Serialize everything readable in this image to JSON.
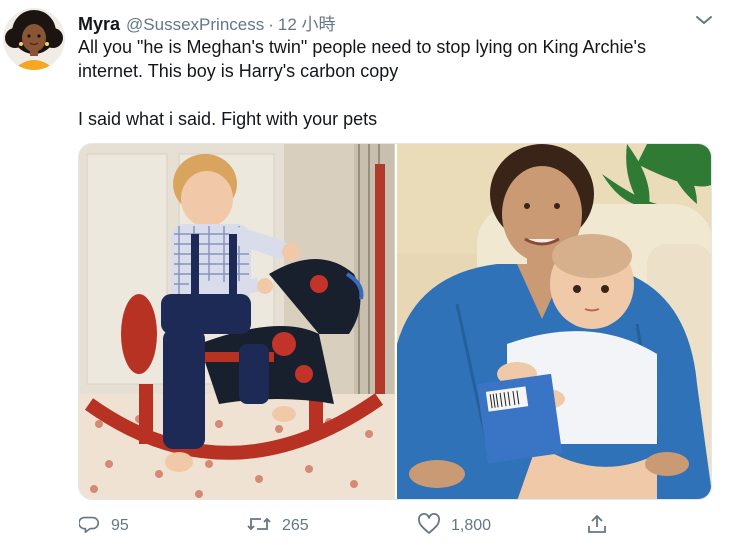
{
  "tweet": {
    "author": {
      "display_name": "Myra",
      "handle": "@SussexPrincess",
      "separator": "·",
      "time": "12 小時"
    },
    "text_lines": [
      "All you \"he is Meghan's twin\" people need to stop lying on King Archie's",
      "internet. This boy is Harry's carbon copy",
      "I said what i said. Fight with your pets"
    ],
    "media": {
      "images": [
        {
          "name": "toddler-on-rocking-horse-photo"
        },
        {
          "name": "woman-holding-baby-photo"
        }
      ]
    },
    "actions": {
      "reply_count": "95",
      "retweet_count": "265",
      "like_count": "1,800"
    },
    "icons": {
      "caret": "chevron-down-icon",
      "reply": "reply-bubble-icon",
      "retweet": "retweet-arrows-icon",
      "like": "heart-icon",
      "share": "share-upload-icon"
    },
    "colors": {
      "text": "#14171a",
      "secondary_text": "#657786",
      "border": "#e1e8ed"
    }
  }
}
